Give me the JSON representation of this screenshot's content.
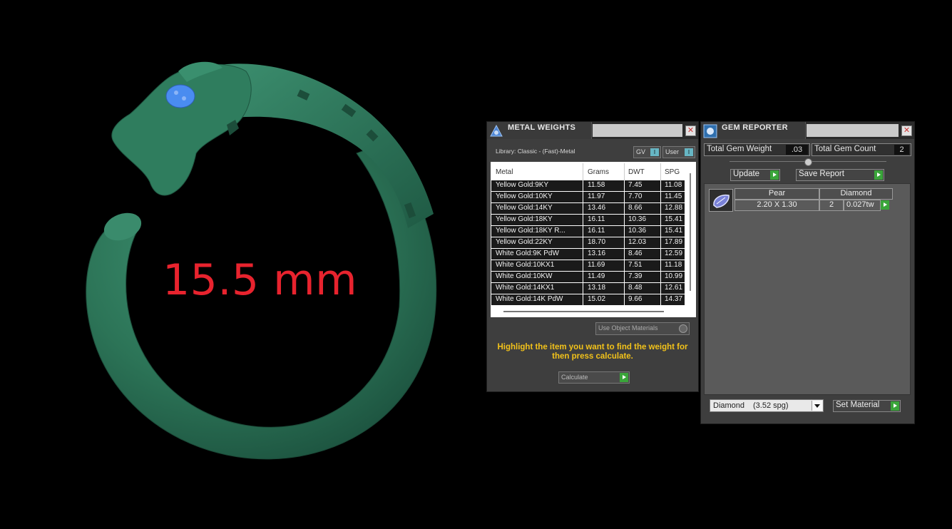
{
  "viewport": {
    "measurement_label": "15.5 mm",
    "model_color": "#2f7a5e",
    "gem_color": "#4a8cf0"
  },
  "metal_weights": {
    "title": "METAL WEIGHTS",
    "library_label": "Library: Classic - (Fast)-Metal",
    "toggle_gv": "GV",
    "toggle_user": "User",
    "toggle_indicator": "I",
    "columns": [
      "Metal",
      "Grams",
      "DWT",
      "SPG"
    ],
    "rows": [
      [
        "Yellow Gold:9KY",
        "11.58",
        "7.45",
        "11.08"
      ],
      [
        "Yellow Gold:10KY",
        "11.97",
        "7.70",
        "11.45"
      ],
      [
        "Yellow Gold:14KY",
        "13.46",
        "8.66",
        "12.88"
      ],
      [
        "Yellow Gold:18KY",
        "16.11",
        "10.36",
        "15.41"
      ],
      [
        "Yellow Gold:18KY R...",
        "16.11",
        "10.36",
        "15.41"
      ],
      [
        "Yellow Gold:22KY",
        "18.70",
        "12.03",
        "17.89"
      ],
      [
        "White Gold:9K PdW",
        "13.16",
        "8.46",
        "12.59"
      ],
      [
        "White Gold:10KX1",
        "11.69",
        "7.51",
        "11.18"
      ],
      [
        "White Gold:10KW",
        "11.49",
        "7.39",
        "10.99"
      ],
      [
        "White Gold:14KX1",
        "13.18",
        "8.48",
        "12.61"
      ],
      [
        "White Gold:14K PdW",
        "15.02",
        "9.66",
        "14.37"
      ]
    ],
    "use_object_materials": "Use Object Materials",
    "hint": "Highlight the item you want to find the weight for then press calculate.",
    "calculate_label": "Calculate"
  },
  "gem_reporter": {
    "title": "GEM REPORTER",
    "total_weight_label": "Total Gem Weight",
    "total_weight_value": ".03",
    "total_count_label": "Total Gem Count",
    "total_count_value": "2",
    "update_label": "Update",
    "save_report_label": "Save Report",
    "gem": {
      "shape": "Pear",
      "material": "Diamond",
      "size": "2.20 X 1.30",
      "count": "2",
      "weight": "0.027tw"
    },
    "material_select": "Diamond",
    "material_spg": "(3.52 spg)",
    "set_material_label": "Set Material"
  }
}
